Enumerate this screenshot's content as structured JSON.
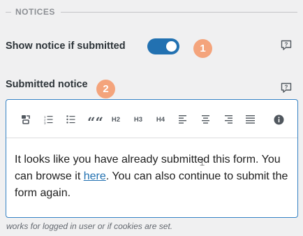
{
  "section": {
    "title": "NOTICES"
  },
  "show_notice": {
    "label": "Show notice if submitted",
    "enabled": true,
    "badge": "1"
  },
  "submitted_notice": {
    "label": "Submitted notice",
    "badge": "2"
  },
  "toolbar": {
    "buttons": [
      {
        "name": "format-icon"
      },
      {
        "name": "ordered-list-icon"
      },
      {
        "name": "unordered-list-icon"
      },
      {
        "name": "blockquote-icon",
        "text": "““"
      },
      {
        "name": "heading-2",
        "text": "H2"
      },
      {
        "name": "heading-3",
        "text": "H3"
      },
      {
        "name": "heading-4",
        "text": "H4"
      },
      {
        "name": "align-left-icon"
      },
      {
        "name": "align-center-icon"
      },
      {
        "name": "align-right-icon"
      },
      {
        "name": "align-justify-icon"
      },
      {
        "name": "info-icon"
      }
    ]
  },
  "editor": {
    "text_before": "It looks like you have already submitted this form. You can browse it ",
    "link_text": "here",
    "text_after": ". You can also continue to submit the form again."
  },
  "hint": "works for logged in user or if cookies are set.",
  "colors": {
    "accent": "#2271b1",
    "badge": "#f4a47c",
    "background": "#f0f0f1"
  }
}
